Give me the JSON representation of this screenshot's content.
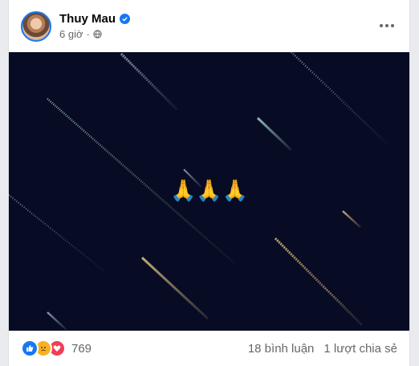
{
  "post": {
    "author": "Thuy Mau",
    "time": "6 giờ",
    "separator": "·",
    "privacy_icon": "globe-icon",
    "verified_icon": "verified-badge-icon",
    "more_icon": "more-options-icon",
    "image": {
      "caption_emoji": "🙏🙏🙏",
      "background": "#080b24"
    },
    "reactions": {
      "types": [
        "like",
        "sad",
        "love"
      ],
      "count": "769"
    },
    "comments": "18 bình luận",
    "shares": "1 lượt chia sẻ"
  },
  "colors": {
    "accent": "#1877f2",
    "secondary_text": "#65676b"
  }
}
